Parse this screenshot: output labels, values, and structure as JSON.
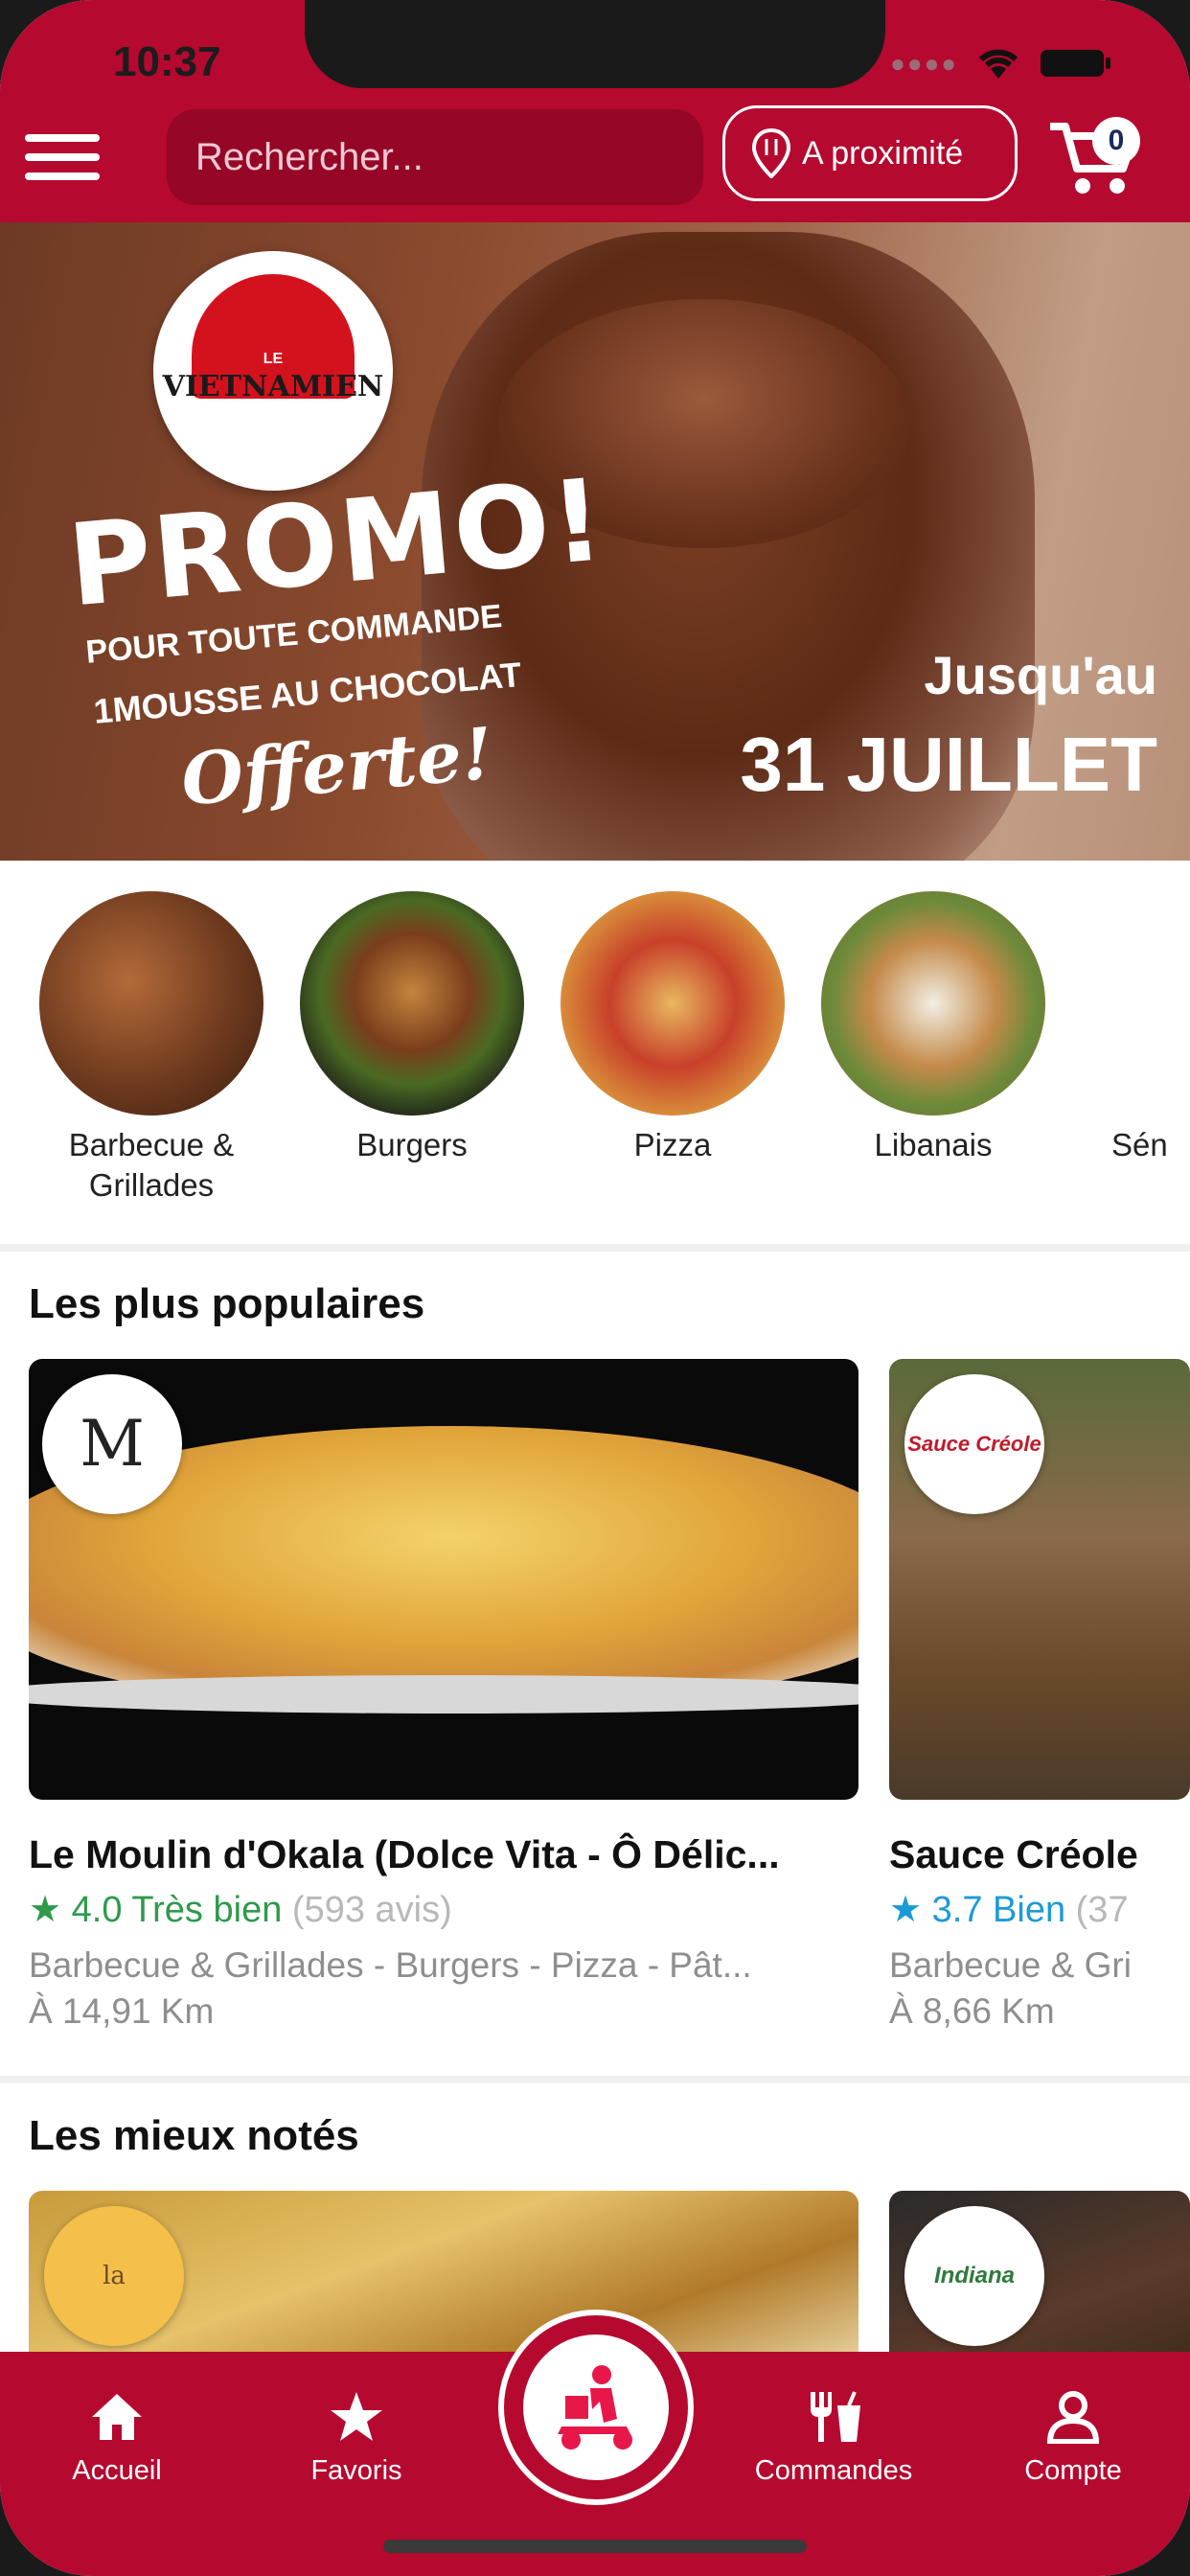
{
  "status_bar": {
    "time": "10:37"
  },
  "header": {
    "search_placeholder": "Rechercher...",
    "nearby_label": "A proximité",
    "cart_count": "0"
  },
  "banner": {
    "brand_small": "LE",
    "brand": "VIETNAMIEN",
    "promo": "PROMO!",
    "line1": "POUR TOUTE COMMANDE",
    "line2": "1MOUSSE AU CHOCOLAT",
    "line3": "Offerte!",
    "until_label": "Jusqu'au",
    "until_date": "31 JUILLET"
  },
  "categories": [
    {
      "label": "Barbecue & Grillades"
    },
    {
      "label": "Burgers"
    },
    {
      "label": "Pizza"
    },
    {
      "label": "Libanais"
    },
    {
      "label": "Sén"
    }
  ],
  "sections": {
    "popular_title": "Les plus populaires",
    "top_rated_title": "Les mieux notés"
  },
  "popular": [
    {
      "logo": "M",
      "name": "Le Moulin d'Okala (Dolce Vita - Ô Délic...",
      "rating": "4.0",
      "rating_label": "Très bien",
      "reviews": "(593 avis)",
      "categories": "Barbecue & Grillades - Burgers - Pizza - Pât...",
      "distance": "À 14,91 Km",
      "star_color": "#2e9a4a"
    },
    {
      "logo": "Sauce Créole",
      "name": "Sauce Créole",
      "rating": "3.7",
      "rating_label": "Bien",
      "reviews": "(37",
      "categories": "Barbecue & Gri",
      "distance": "À 8,66 Km",
      "star_color": "#1b9ad8"
    }
  ],
  "top_rated": [
    {
      "logo": "la Crêperie"
    },
    {
      "logo": "Indiana"
    }
  ],
  "nav": {
    "home": "Accueil",
    "favorites": "Favoris",
    "orders": "Commandes",
    "account": "Compte"
  },
  "colors": {
    "brand": "#b5092f",
    "brand_dark": "#950627"
  }
}
